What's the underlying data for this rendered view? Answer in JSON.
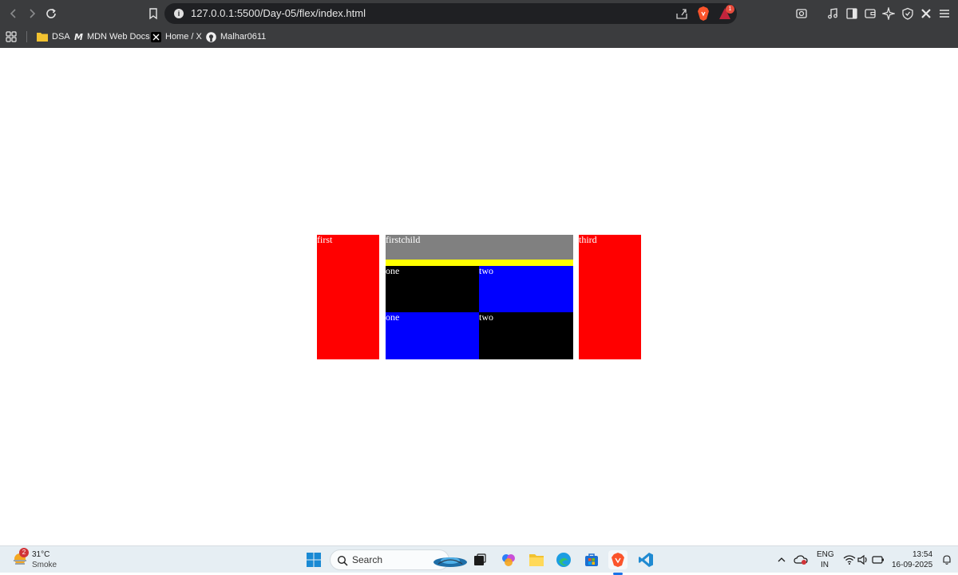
{
  "browser": {
    "url": "127.0.0.1:5500/Day-05/flex/index.html",
    "notification_badge": "1",
    "bookmarks": [
      {
        "label": "DSA",
        "icon": "folder-icon"
      },
      {
        "label": "MDN Web Docs",
        "icon": "mdn-icon"
      },
      {
        "label": "Home / X",
        "icon": "x-logo-icon"
      },
      {
        "label": "Malhar0611",
        "icon": "github-icon"
      }
    ]
  },
  "page": {
    "first_label": "first",
    "firstchild_label": "firstchild",
    "third_label": "third",
    "grid": {
      "r1c1": "one",
      "r1c2": "two",
      "r2c1": "one",
      "r2c2": "two"
    },
    "colors": {
      "red": "#ff0000",
      "gray": "#808080",
      "yellow": "#ffff00",
      "black": "#000000",
      "blue": "#0000ff"
    }
  },
  "taskbar": {
    "weather_temp": "31°C",
    "weather_desc": "Smoke",
    "weather_badge": "2",
    "search_placeholder": "Search",
    "lang_line1": "ENG",
    "lang_line2": "IN",
    "time": "13:54",
    "date": "16-09-2025"
  }
}
